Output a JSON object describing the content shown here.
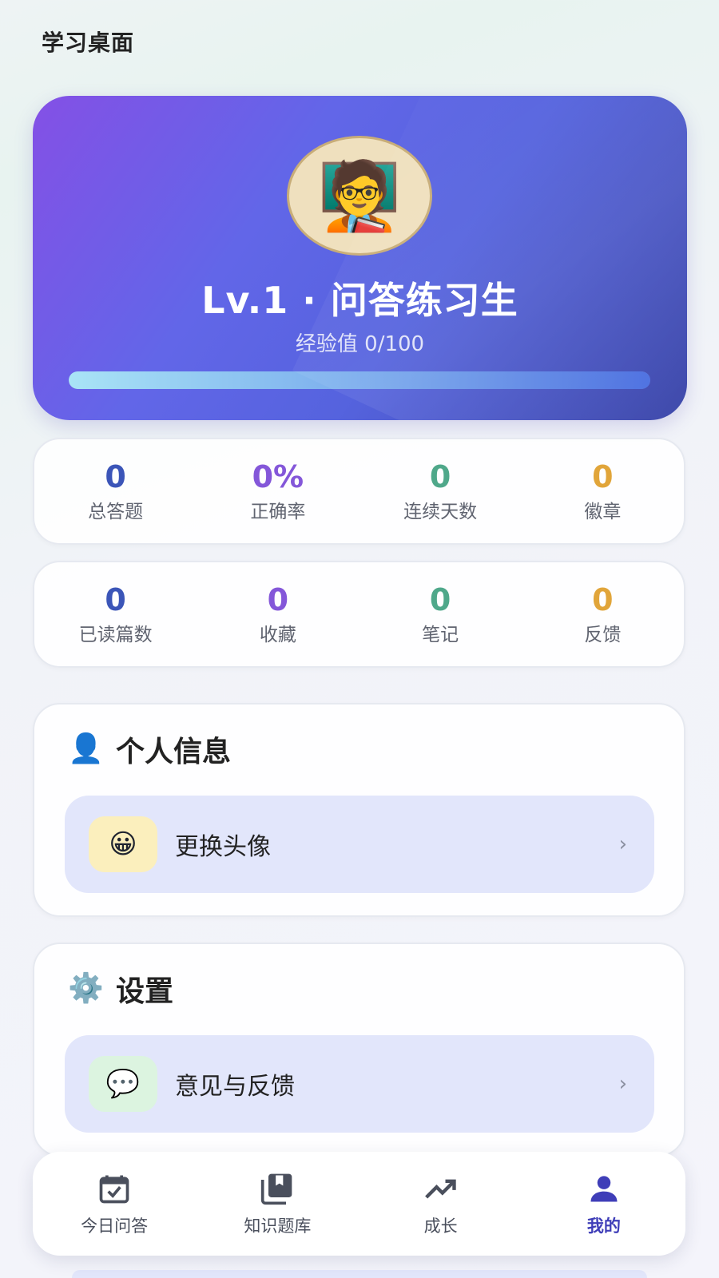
{
  "header": {
    "title": "学习桌面"
  },
  "profile": {
    "level_title": "Lv.1 · 问答练习生",
    "exp_text": "经验值 0/100",
    "exp_progress": 1.0,
    "avatar_emoji": "🧑‍🏫"
  },
  "stats_row1": [
    {
      "value": "0",
      "label": "总答题",
      "color": "#3b55b8"
    },
    {
      "value": "0%",
      "label": "正确率",
      "color": "#8457d9"
    },
    {
      "value": "0",
      "label": "连续天数",
      "color": "#4fa88a"
    },
    {
      "value": "0",
      "label": "徽章",
      "color": "#e1a53a"
    }
  ],
  "stats_row2": [
    {
      "value": "0",
      "label": "已读篇数",
      "color": "#3b55b8"
    },
    {
      "value": "0",
      "label": "收藏",
      "color": "#8457d9"
    },
    {
      "value": "0",
      "label": "笔记",
      "color": "#4fa88a"
    },
    {
      "value": "0",
      "label": "反馈",
      "color": "#e1a53a"
    }
  ],
  "sections": {
    "personal": {
      "icon": "👤",
      "title": "个人信息",
      "items": [
        {
          "icon": "😀",
          "label": "更换头像",
          "chevron": "›"
        }
      ]
    },
    "settings": {
      "icon": "⚙️",
      "title": "设置",
      "items": [
        {
          "icon": "💬",
          "label": "意见与反馈",
          "chevron": "›"
        }
      ]
    }
  },
  "tabbar": {
    "tabs": [
      {
        "label": "今日问答",
        "icon": "calendar-check-icon"
      },
      {
        "label": "知识题库",
        "icon": "library-icon"
      },
      {
        "label": "成长",
        "icon": "trending-up-icon"
      },
      {
        "label": "我的",
        "icon": "person-icon"
      }
    ],
    "active_index": 3,
    "active_color": "#3f3eb8"
  }
}
